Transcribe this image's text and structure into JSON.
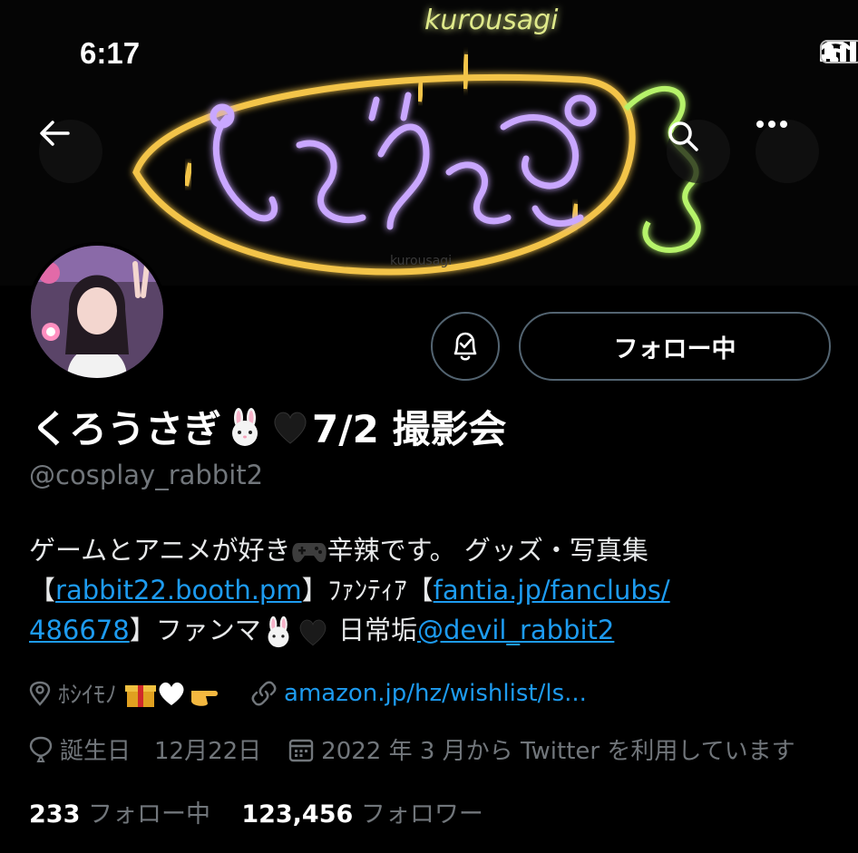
{
  "status": {
    "time": "6:17"
  },
  "banner": {
    "sign_top_text": "kurousagi",
    "sign_main_text": "くろうさぎ",
    "sign_small_text": "kurousagi"
  },
  "follow_button": {
    "label": "フォロー中"
  },
  "profile": {
    "name": "くろうさぎ",
    "name_suffix": "7/2 撮影会",
    "handle": "@cosplay_rabbit2"
  },
  "bio": {
    "part1": "ゲームとアニメが好き",
    "part2": "辛辣です。 グッズ・写真集",
    "bracket_open1": "【",
    "link1": "rabbit22.booth.pm",
    "part3": "】ﾌｧﾝﾃｨｱ【",
    "link2": "fantia.jp/fanclubs/",
    "link2b": "486678",
    "part4": "】ファンマ",
    "part5": " 日常垢",
    "mention": "@devil_rabbit2"
  },
  "meta": {
    "location": "ﾎｼｲﾓﾉ",
    "website": "amazon.jp/hz/wishlist/ls...",
    "birthday": "誕生日　12月22日",
    "joined": "2022 年 3 月から Twitter を利用しています"
  },
  "stats": {
    "following_count": "233",
    "following_label": "フォロー中",
    "followers_count": "123,456",
    "followers_label": "フォロワー"
  },
  "colors": {
    "link": "#1d9bf0",
    "muted": "#71767b",
    "neon_yellow": "#f3c44a",
    "neon_purple": "#c9a7ff",
    "neon_green": "#b6f36a"
  }
}
